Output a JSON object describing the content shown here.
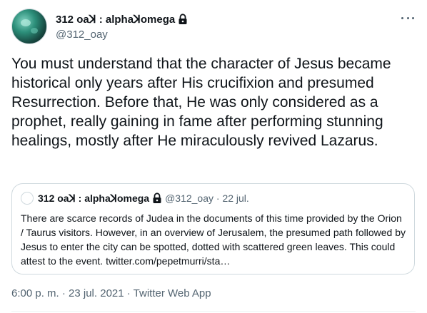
{
  "author": {
    "display_name": "312 oaꓘ : alphaꓘomega",
    "handle": "@312_oay"
  },
  "tweet": {
    "text": "You must understand that the character of Jesus became historical only years after His crucifixion and presumed Resurrection. Before that, He was only considered as a prophet, really gaining in fame after performing stunning healings, mostly after He miraculously revived Lazarus."
  },
  "quote": {
    "display_name": "312 oaꓘ : alphaꓘomega",
    "meta": "@312_oay · 22 jul.",
    "text": "There are scarce records of Judea in the documents of this time provided by the Orion / Taurus visitors. However, in an overview of Jerusalem, the presumed path followed by Jesus to enter the city can be spotted, dotted with scattered green leaves. This could attest to the event. twitter.com/pepetmurri/sta…"
  },
  "footer": {
    "timestamp": "6:00 p. m. · 23 jul. 2021 · Twitter Web App"
  },
  "icons": {
    "lock": "lock-icon",
    "more": "more-icon"
  }
}
